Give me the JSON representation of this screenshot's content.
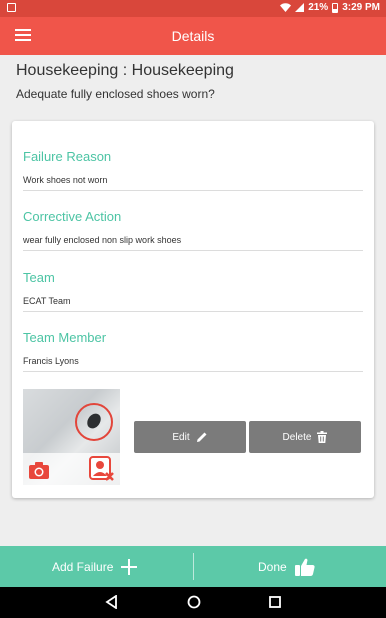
{
  "status_bar": {
    "battery_percent": "21%",
    "time": "3:29 PM"
  },
  "app_bar": {
    "title": "Details",
    "menu_icon": "hamburger-menu-icon"
  },
  "header": {
    "title": "Housekeeping : Housekeeping",
    "question": "Adequate fully enclosed shoes worn?"
  },
  "fields": [
    {
      "label": "Failure Reason",
      "value": "Work shoes not worn"
    },
    {
      "label": "Corrective Action",
      "value": "wear fully enclosed non slip work shoes"
    },
    {
      "label": "Team",
      "value": "ECAT Team"
    },
    {
      "label": "Team Member",
      "value": "Francis Lyons"
    }
  ],
  "photo": {
    "camera_icon": "camera-icon",
    "remove_person_icon": "remove-person-icon"
  },
  "actions": {
    "edit_label": "Edit",
    "edit_icon": "pencil-icon",
    "delete_label": "Delete",
    "delete_icon": "trash-icon"
  },
  "bottom_bar": {
    "add_failure_label": "Add Failure",
    "add_icon": "plus-icon",
    "done_label": "Done",
    "done_icon": "thumbs-up-icon"
  },
  "colors": {
    "status_bar": "#d9473b",
    "app_bar": "#f0554a",
    "accent": "#4cc4a4",
    "bottom_bar": "#5cc9a8",
    "action_button": "#7b7b7b"
  }
}
